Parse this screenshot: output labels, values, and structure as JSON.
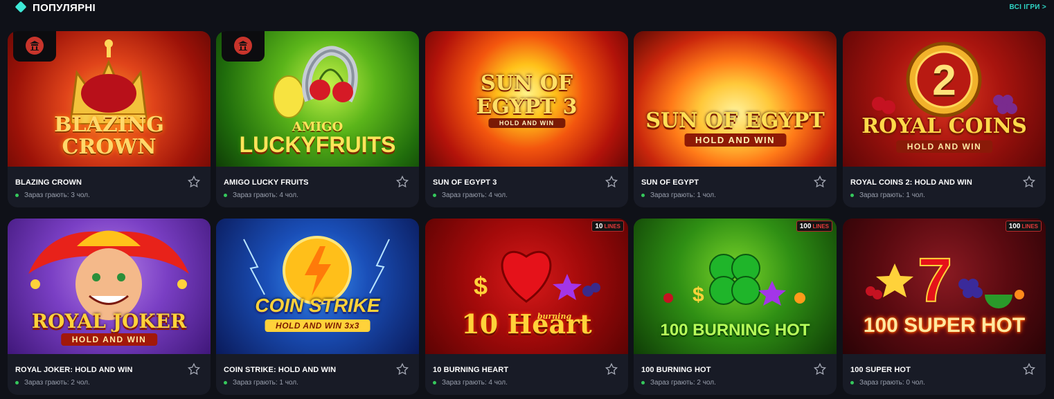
{
  "header": {
    "title": "ПОПУЛЯРНІ",
    "all_games_label": "ВСІ ІГРИ >"
  },
  "colors": {
    "accent": "#2fd6c6",
    "card_bg": "#181b26",
    "page_bg": "#0f1118",
    "online_dot": "#35c85c"
  },
  "games": [
    {
      "title": "BLAZING CROWN",
      "status": "Зараз грають: 3 чол.",
      "logo_line1": "BLAZING",
      "logo_line2": "CROWN"
    },
    {
      "title": "AMIGO LUCKY FRUITS",
      "status": "Зараз грають: 4 чол.",
      "logo_line1": "AMIGO",
      "logo_line2": "LUCKYFRUITS"
    },
    {
      "title": "SUN OF EGYPT 3",
      "status": "Зараз грають: 4 чол.",
      "logo_line1": "SUN OF",
      "logo_line2": "EGYPT 3",
      "logo_sub": "HOLD AND WIN"
    },
    {
      "title": "SUN OF EGYPT",
      "status": "Зараз грають: 1 чол.",
      "logo_line1": "SUN OF EGYPT",
      "logo_sub": "HOLD AND WIN"
    },
    {
      "title": "ROYAL COINS 2: HOLD AND WIN",
      "status": "Зараз грають: 1 чол.",
      "logo_big": "2",
      "logo_line1": "ROYAL COINS",
      "logo_sub": "HOLD AND WIN"
    },
    {
      "title": "ROYAL JOKER: HOLD AND WIN",
      "status": "Зараз грають: 2 чол.",
      "logo_line1": "ROYAL JOKER",
      "logo_sub": "HOLD AND WIN"
    },
    {
      "title": "COIN STRIKE: HOLD AND WIN",
      "status": "Зараз грають: 1 чол.",
      "logo_line1": "COIN STRIKE",
      "logo_sub": "HOLD AND WIN 3x3"
    },
    {
      "title": "10 BURNING HEART",
      "status": "Зараз грають: 4 чол.",
      "logo_line1": "10 Heart",
      "logo_small": "burning",
      "badge_num": "10",
      "badge_label": "LINES"
    },
    {
      "title": "100 BURNING HOT",
      "status": "Зараз грають: 2 чол.",
      "logo_line1": "100 BURNING HOT",
      "badge_num": "100",
      "badge_label": "LINES"
    },
    {
      "title": "100 SUPER HOT",
      "status": "Зараз грають: 0 чол.",
      "logo_line1": "100 SUPER HOT",
      "badge_num": "100",
      "badge_label": "LINES"
    }
  ]
}
